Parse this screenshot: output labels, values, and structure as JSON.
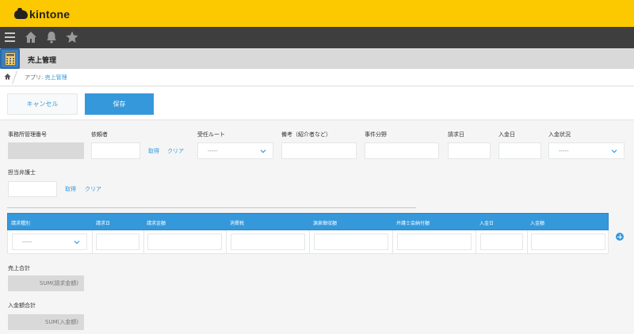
{
  "header": {
    "logo_text": "kintone",
    "brand_color": "#fcc800"
  },
  "nav": {
    "icons": [
      "menu-icon",
      "home-icon",
      "bell-icon",
      "star-icon"
    ]
  },
  "app": {
    "title": "売上管理"
  },
  "breadcrumb": {
    "prefix": "アプリ: ",
    "link": "売上管理"
  },
  "actions": {
    "cancel_label": "キャンセル",
    "save_label": "保存"
  },
  "form": {
    "office_number_label": "事務所管理番号",
    "requester_label": "依頼者",
    "reception_route_label": "受任ルート",
    "reception_route_value": "-----",
    "remarks_label": "備考（紹介者など）",
    "case_field_label": "事件分野",
    "billing_date_label": "請求日",
    "payment_date_label": "入金日",
    "payment_status_label": "入金状況",
    "payment_status_value": "-----",
    "attorney_label": "担当弁護士",
    "fetch_label": "取得",
    "clear_label": "クリア"
  },
  "table": {
    "columns": [
      "請求種別",
      "請求日",
      "請求金額",
      "消費税",
      "源泉徴収額",
      "弁護士会納付額",
      "入金日",
      "入金額"
    ],
    "row_select_value": "-----"
  },
  "totals": {
    "sales_total_label": "売上合計",
    "sales_total_value": "SUM(請求金額)",
    "payment_total_label": "入金額合計",
    "payment_total_value": "SUM(入金額)"
  },
  "colors": {
    "accent": "#3498db",
    "nav_bg": "#3e3e3e"
  }
}
